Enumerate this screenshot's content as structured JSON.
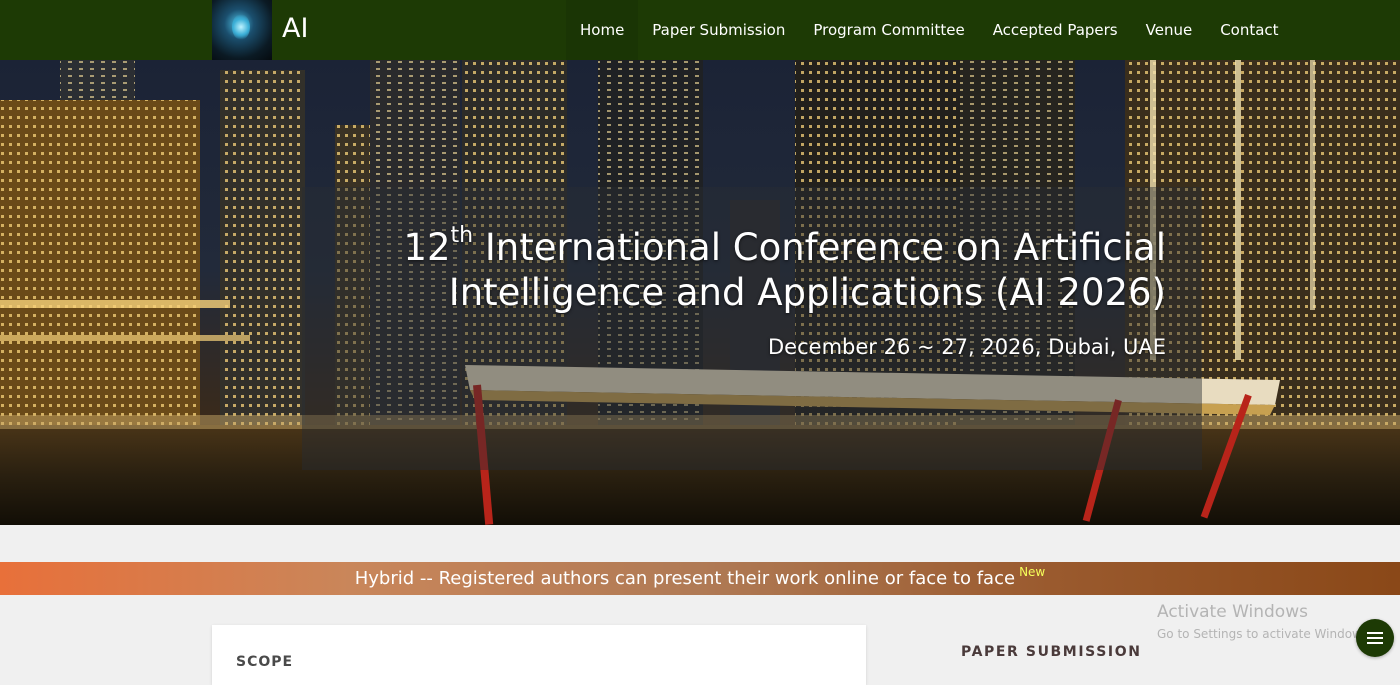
{
  "brand": {
    "name": "AI"
  },
  "nav": {
    "items": [
      {
        "label": "Home",
        "active": true
      },
      {
        "label": "Paper Submission"
      },
      {
        "label": "Program Committee"
      },
      {
        "label": "Accepted Papers"
      },
      {
        "label": "Venue"
      },
      {
        "label": "Contact"
      }
    ]
  },
  "hero": {
    "title_ordinal_number": "12",
    "title_ordinal_suffix": "th",
    "title_line1_rest": " International Conference on Artificial",
    "title_line2": "Intelligence and Applications (AI 2026)",
    "date_location": "December 26 ~ 27, 2026, Dubai, UAE"
  },
  "banner": {
    "text": "Hybrid -- Registered authors can present their work online or face to face",
    "badge": "New"
  },
  "main": {
    "scope_heading": "SCOPE"
  },
  "sidebar": {
    "heading": "PAPER SUBMISSION"
  },
  "windows_watermark": {
    "title": "Activate Windows",
    "subtitle": "Go to Settings to activate Windows."
  },
  "colors": {
    "navbar_bg": "#1d3a05",
    "banner_start": "#e8703a",
    "banner_end": "#8a4818",
    "new_badge": "#f6ff5a"
  }
}
